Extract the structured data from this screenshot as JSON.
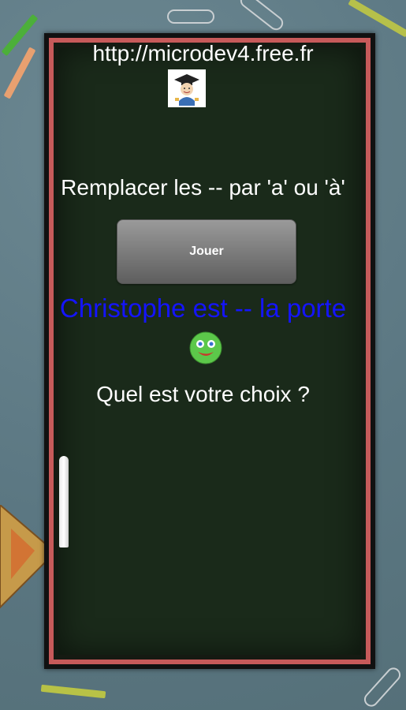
{
  "site": {
    "url": "http://microdev4.free.fr"
  },
  "game": {
    "instruction": "Remplacer les -- par 'a' ou 'à'",
    "play_label": "Jouer",
    "sentence": "Christophe est -- la porte",
    "question": "Quel est votre choix ?"
  },
  "icons": {
    "logo": "graduate-student-icon",
    "feedback": "green-smiley-icon"
  },
  "colors": {
    "board": "#1a2a1a",
    "frame": "#c75a5a",
    "sentence": "#1414ff",
    "text": "#ffffff"
  }
}
